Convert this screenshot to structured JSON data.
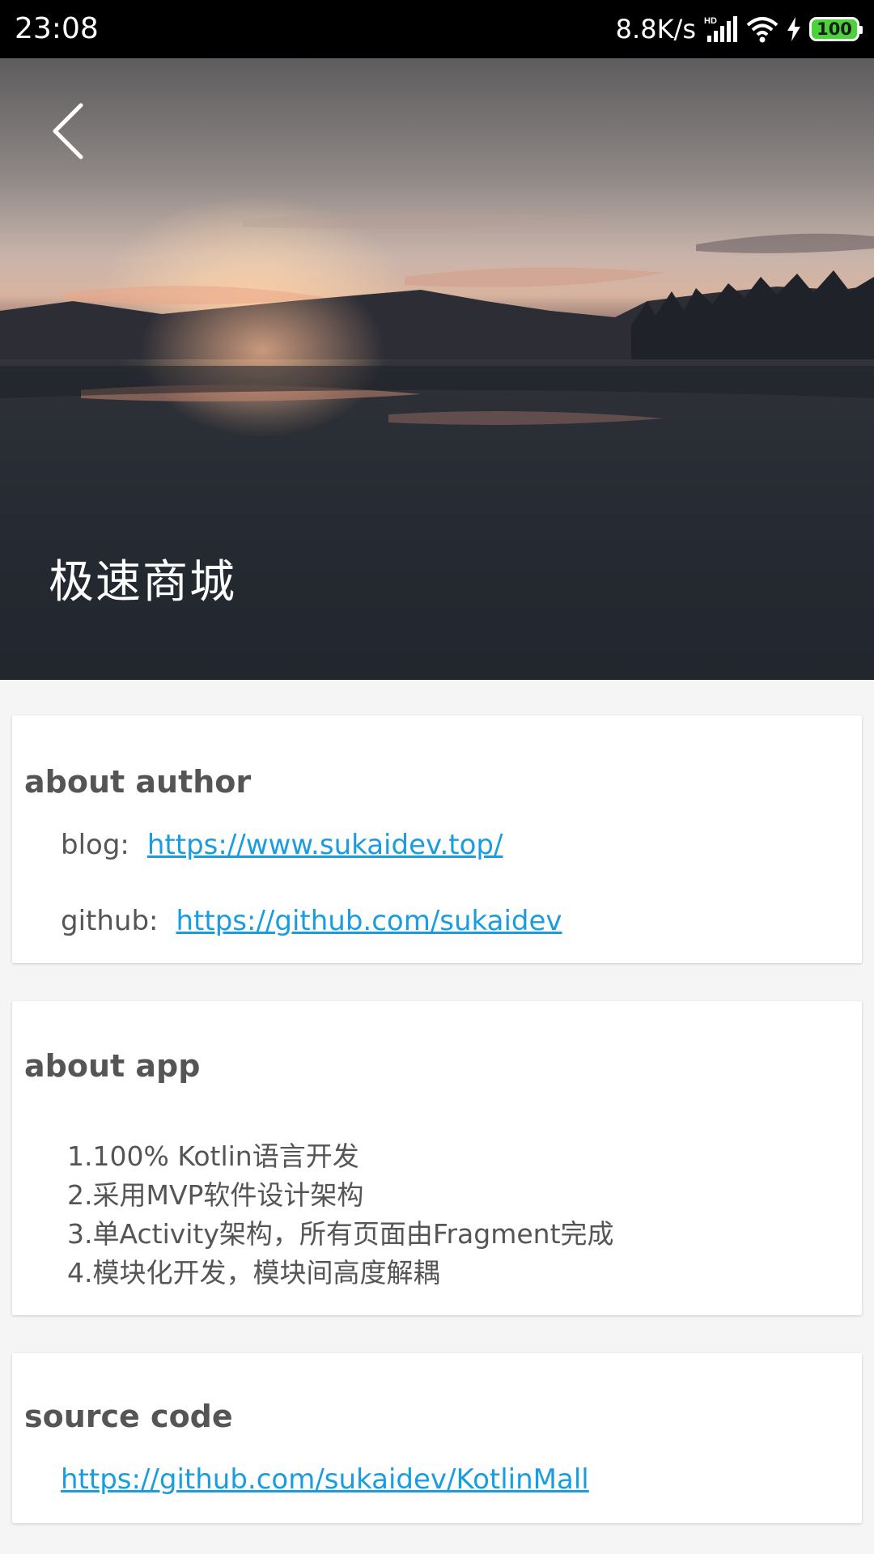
{
  "status_bar": {
    "time": "23:08",
    "net_speed": "8.8K/s",
    "network_badge": "HD",
    "battery_level": "100",
    "icons": [
      "signal-icon",
      "wifi-icon",
      "charging-icon",
      "battery-icon"
    ]
  },
  "header": {
    "back_icon": "back-arrow-icon",
    "title": "极速商城"
  },
  "about_author": {
    "title": "about author",
    "blog_label": "blog:",
    "blog_url": "https://www.sukaidev.top/",
    "github_label": "github:",
    "github_url": "https://github.com/sukaidev"
  },
  "about_app": {
    "title": "about app",
    "features": [
      "1.100% Kotlin语言开发",
      "2.采用MVP软件设计架构",
      "3.单Activity架构，所有页面由Fragment完成",
      "4.模块化开发，模块间高度解耦"
    ]
  },
  "source_code": {
    "title": "source code",
    "url": "https://github.com/sukaidev/KotlinMall"
  },
  "colors": {
    "link": "#1a9de0",
    "text": "#555555",
    "background": "#f5f5f5",
    "battery": "#4cd23a"
  }
}
